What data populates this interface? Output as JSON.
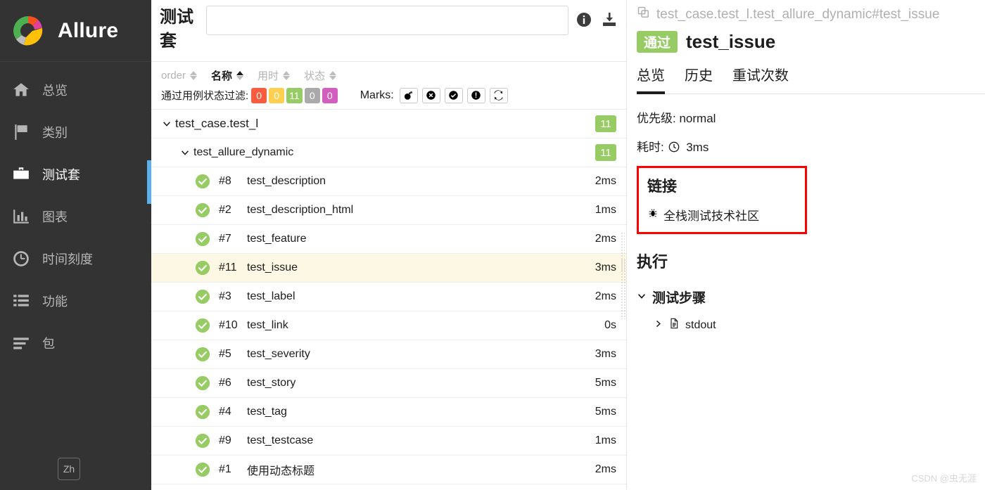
{
  "sidebar": {
    "brand": "Allure",
    "logo_icon": "allure-logo-icon",
    "items": [
      {
        "label": "总览",
        "icon": "home-icon",
        "active": false
      },
      {
        "label": "类别",
        "icon": "flag-icon",
        "active": false
      },
      {
        "label": "测试套",
        "icon": "briefcase-icon",
        "active": true
      },
      {
        "label": "图表",
        "icon": "bar-chart-icon",
        "active": false
      },
      {
        "label": "时间刻度",
        "icon": "clock-icon",
        "active": false
      },
      {
        "label": "功能",
        "icon": "list-icon",
        "active": false
      },
      {
        "label": "包",
        "icon": "lines-icon",
        "active": false
      }
    ],
    "language_button": "Zh"
  },
  "middle": {
    "title": "测试套",
    "search": {
      "value": "",
      "placeholder": ""
    },
    "info_icon": "info-icon",
    "download_icon": "download-icon",
    "sort_columns": [
      {
        "label": "order",
        "active": false
      },
      {
        "label": "名称",
        "active": true
      },
      {
        "label": "用时",
        "active": false
      },
      {
        "label": "状态",
        "active": false
      }
    ],
    "filter_label": "通过用例状态过滤:",
    "status_filters": [
      {
        "count": "0",
        "color": "#fd5a3e"
      },
      {
        "count": "0",
        "color": "#ffd050"
      },
      {
        "count": "11",
        "color": "#97cc64"
      },
      {
        "count": "0",
        "color": "#aaaaaa"
      },
      {
        "count": "0",
        "color": "#d35ebe"
      }
    ],
    "marks_label": "Marks:",
    "marks": [
      {
        "icon": "bomb-icon"
      },
      {
        "icon": "x-circle-icon"
      },
      {
        "icon": "check-circle-icon"
      },
      {
        "icon": "exclamation-circle-icon"
      },
      {
        "icon": "retry-icon"
      }
    ],
    "tree": {
      "root": {
        "label": "test_case.test_l",
        "count": "11"
      },
      "group": {
        "label": "test_allure_dynamic",
        "count": "11"
      },
      "tests": [
        {
          "order": "#8",
          "name": "test_description",
          "duration": "2ms",
          "status": "passed",
          "selected": false
        },
        {
          "order": "#2",
          "name": "test_description_html",
          "duration": "1ms",
          "status": "passed",
          "selected": false
        },
        {
          "order": "#7",
          "name": "test_feature",
          "duration": "2ms",
          "status": "passed",
          "selected": false
        },
        {
          "order": "#11",
          "name": "test_issue",
          "duration": "3ms",
          "status": "passed",
          "selected": true
        },
        {
          "order": "#3",
          "name": "test_label",
          "duration": "2ms",
          "status": "passed",
          "selected": false
        },
        {
          "order": "#10",
          "name": "test_link",
          "duration": "0s",
          "status": "passed",
          "selected": false
        },
        {
          "order": "#5",
          "name": "test_severity",
          "duration": "3ms",
          "status": "passed",
          "selected": false
        },
        {
          "order": "#6",
          "name": "test_story",
          "duration": "5ms",
          "status": "passed",
          "selected": false
        },
        {
          "order": "#4",
          "name": "test_tag",
          "duration": "5ms",
          "status": "passed",
          "selected": false
        },
        {
          "order": "#9",
          "name": "test_testcase",
          "duration": "1ms",
          "status": "passed",
          "selected": false
        },
        {
          "order": "#1",
          "name": "使用动态标题",
          "duration": "2ms",
          "status": "passed",
          "selected": false
        }
      ]
    }
  },
  "detail": {
    "breadcrumb": "test_case.test_l.test_allure_dynamic#test_issue",
    "copy_icon": "copy-icon",
    "status_badge": "通过",
    "title": "test_issue",
    "tabs": [
      {
        "label": "总览",
        "active": true
      },
      {
        "label": "历史",
        "active": false
      },
      {
        "label": "重试次数",
        "active": false
      }
    ],
    "severity_label": "优先级:",
    "severity_value": "normal",
    "duration_label": "耗时:",
    "duration_value": "3ms",
    "duration_icon": "clock-icon",
    "links_heading": "链接",
    "links": [
      {
        "label": "全栈测试技术社区",
        "icon": "bug-icon"
      }
    ],
    "execution_heading": "执行",
    "steps_heading": "测试步骤",
    "steps_chevron": "chevron-down-icon",
    "attachments": [
      {
        "label": "stdout",
        "icon": "file-icon",
        "chevron": "chevron-right-icon"
      }
    ],
    "highlight_color": "#ff0000"
  },
  "watermark": "CSDN @虫无涯"
}
